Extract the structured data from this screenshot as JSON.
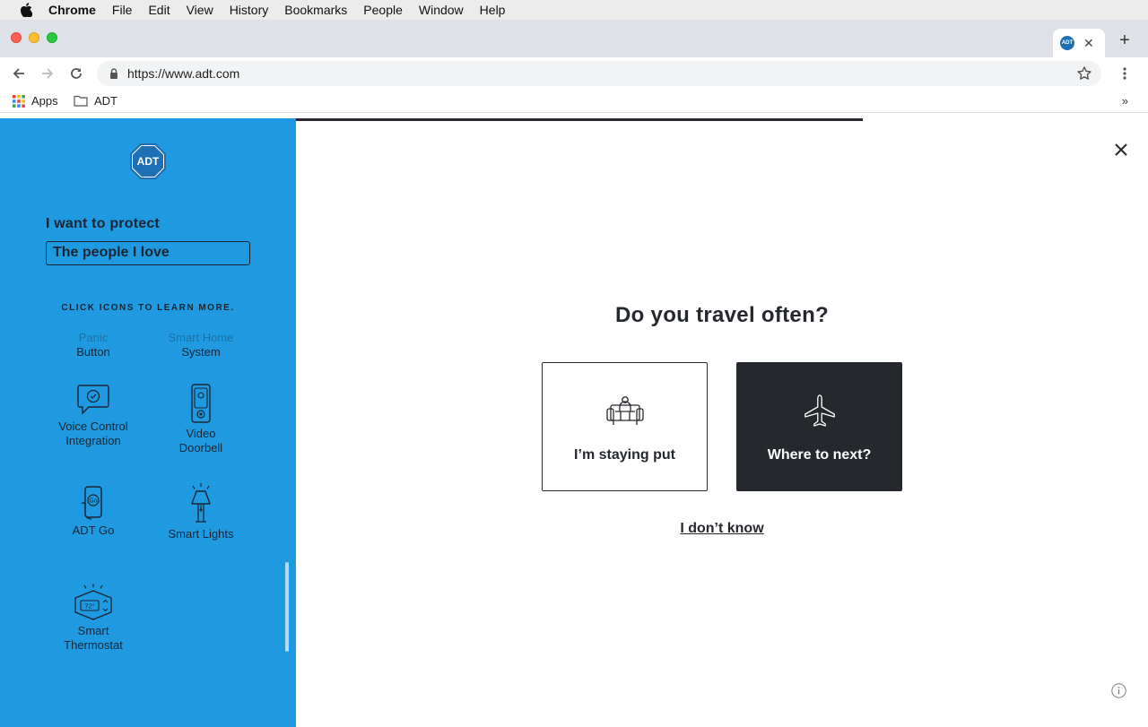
{
  "menubar": {
    "app": "Chrome",
    "items": [
      "File",
      "Edit",
      "View",
      "History",
      "Bookmarks",
      "People",
      "Window",
      "Help"
    ]
  },
  "tab": {
    "favicon_text": "ADT"
  },
  "toolbar": {
    "url": "https://www.adt.com"
  },
  "bookmarks": {
    "items": [
      "Apps",
      "ADT"
    ],
    "more": "»"
  },
  "sidebar": {
    "logo_text": "ADT",
    "protect_label": "I want to protect",
    "protect_value": "The people I love",
    "learn_more": "CLICK ICONS TO LEARN MORE.",
    "features": [
      {
        "line1": "Panic",
        "line2": "Button"
      },
      {
        "line1": "Smart Home",
        "line2": "System"
      },
      {
        "line1": "Voice Control",
        "line2": "Integration"
      },
      {
        "line1": "Video",
        "line2": "Doorbell"
      },
      {
        "line1": "ADT Go",
        "line2": ""
      },
      {
        "line1": "Smart Lights",
        "line2": ""
      },
      {
        "line1": "Smart",
        "line2": "Thermostat"
      }
    ],
    "thermostat_display": "72°",
    "adtgo_badge": "Go"
  },
  "main": {
    "question": "Do you travel often?",
    "option_stay": "I’m staying put",
    "option_travel": "Where to next?",
    "dont_know": "I don’t know"
  },
  "colors": {
    "sidebar_bg": "#1f9ae0",
    "dark": "#25282d",
    "logo_blue": "#1e6fb3"
  }
}
